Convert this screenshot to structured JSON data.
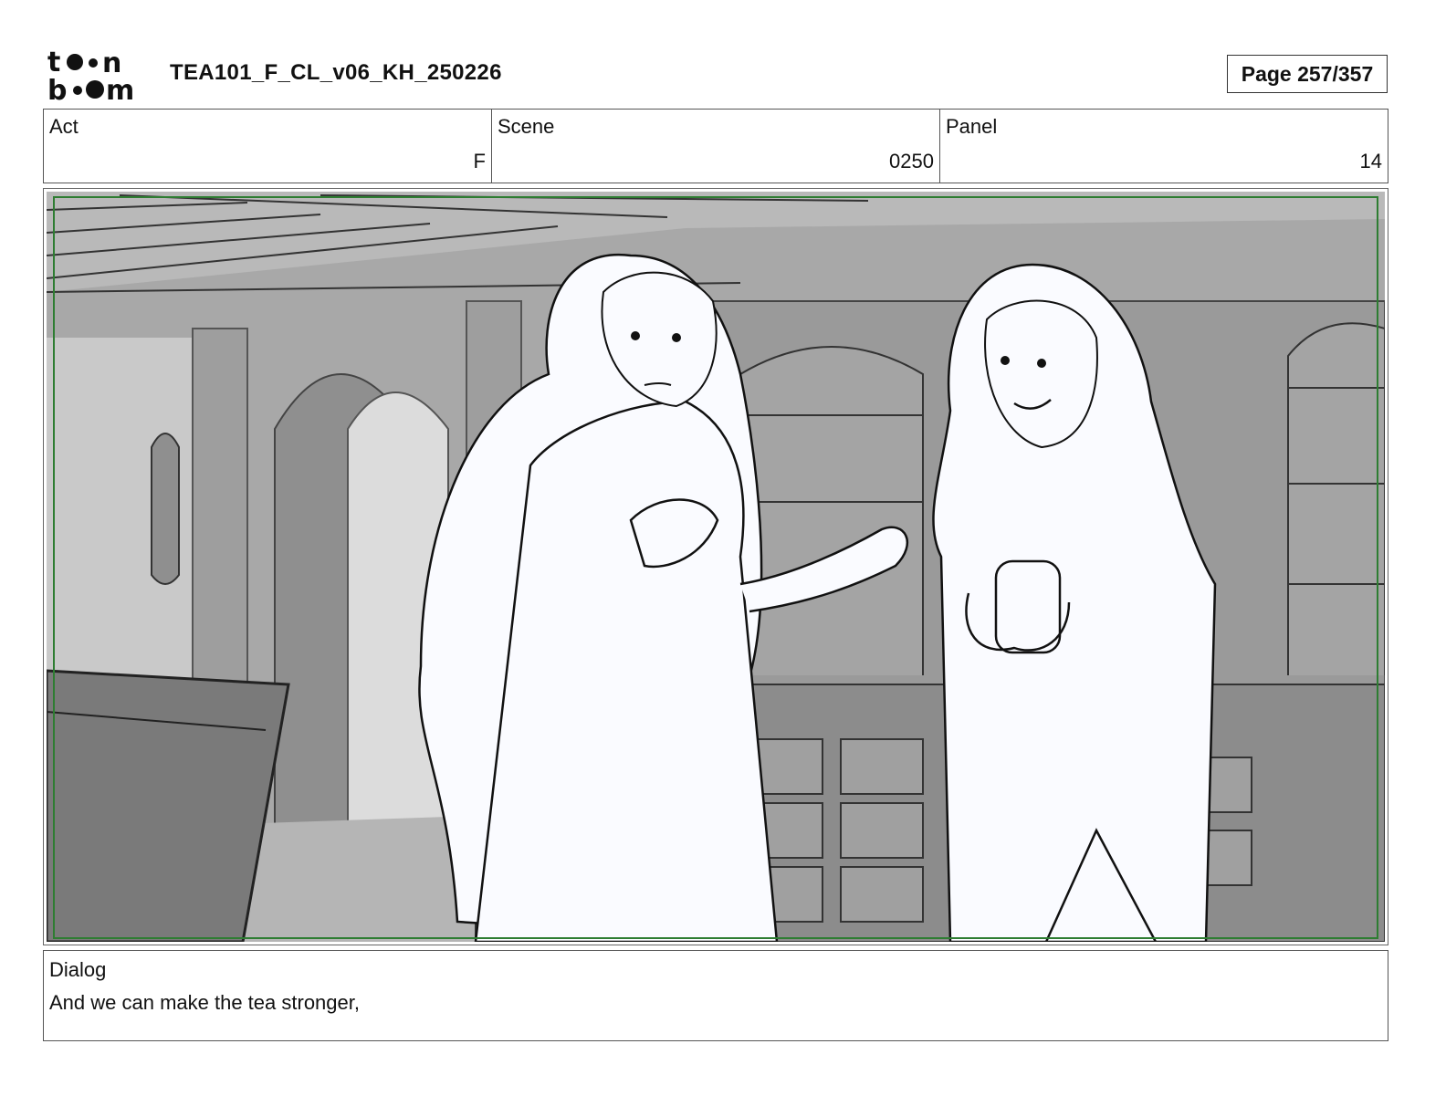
{
  "header": {
    "logo_text_top": "toon",
    "logo_text_bottom": "boom",
    "document_title": "TEA101_F_CL_v06_KH_250226",
    "page_label": "Page 257/357"
  },
  "info": {
    "act": {
      "label": "Act",
      "value": "F"
    },
    "scene": {
      "label": "Scene",
      "value": "0250"
    },
    "panel": {
      "label": "Panel",
      "value": "14"
    }
  },
  "panel_image": {
    "frame_color": "#2e7d32",
    "background_tone": "#a9a9a9",
    "figure_tone": "#fafbff"
  },
  "dialog": {
    "label": "Dialog",
    "text": "And we can make the tea stronger,"
  }
}
